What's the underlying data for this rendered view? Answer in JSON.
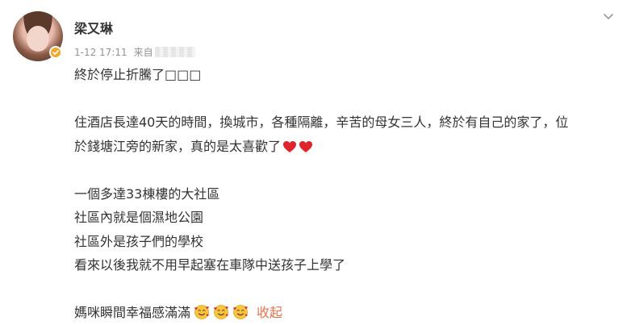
{
  "user": {
    "name": "梁又琳",
    "verified_color": "#f5a623"
  },
  "meta": {
    "time": "1-12 17:11",
    "source_label": "来自"
  },
  "post": {
    "title_line": "終於停止折騰了□□□",
    "paragraph1_line1": "住酒店長達40天的時間，換城市，各種隔離，辛苦的母女三人，終於有自己的家了，位",
    "paragraph1_line2": "於錢塘江旁的新家，真的是太喜歡了",
    "lines": [
      "一個多達33棟樓的大社區",
      "社區內就是個濕地公園",
      "社區外是孩子們的學校",
      "看來以後我就不用早起塞在車隊中送孩子上學了"
    ],
    "last_line": "媽咪瞬間幸福感滿滿",
    "collapse_label": "收起",
    "heart_icon": "red-heart",
    "emoji_icon": "smiling-face-with-hearts"
  },
  "colors": {
    "link": "#eb7350",
    "heart": "#e0242d",
    "text": "#333333",
    "meta": "#939393"
  }
}
